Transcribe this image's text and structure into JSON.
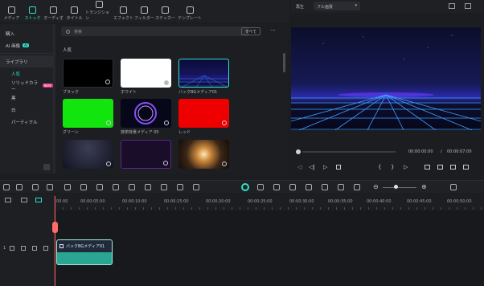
{
  "toolbar": {
    "items": [
      {
        "label": "メディア"
      },
      {
        "label": "ストック"
      },
      {
        "label": "オーディオ"
      },
      {
        "label": "タイトル"
      },
      {
        "label": "トランジション"
      },
      {
        "label": "エフェクト"
      },
      {
        "label": "フィルター"
      },
      {
        "label": "ステッカー"
      },
      {
        "label": "テンプレート"
      }
    ]
  },
  "sidebar": {
    "items": [
      {
        "label": "購入"
      },
      {
        "label": "AI 画像",
        "badge": "AI"
      },
      {
        "label": "ライブラリ"
      },
      {
        "label": "人気"
      },
      {
        "label": "ソリッドカラー",
        "badge": "NEW"
      },
      {
        "label": "黒"
      },
      {
        "label": "白"
      },
      {
        "label": "パーティクル"
      }
    ]
  },
  "media": {
    "search_placeholder": "検索",
    "filter_label": "すべて",
    "more_label": "···",
    "section_title": "人気",
    "thumbnails": [
      {
        "label": "ブラック"
      },
      {
        "label": "ホワイト"
      },
      {
        "label": "バックBGメディア01"
      },
      {
        "label": "グリーン"
      },
      {
        "label": "技術背景メディア 05"
      },
      {
        "label": "レッド"
      },
      {
        "label": ""
      },
      {
        "label": ""
      },
      {
        "label": ""
      }
    ]
  },
  "preview": {
    "mode_label": "再生",
    "quality_label": "フル画質",
    "current_time": "00:00:00:00",
    "separator": "/",
    "total_time": "00:00:07:00"
  },
  "timeline": {
    "ticks": [
      "00:00",
      "00:00:05:00",
      "00:00:10:00",
      "00:00:15:00",
      "00:00:20:00",
      "00:00:25:00",
      "00:00:30:00",
      "00:00:35:00",
      "00:00:40:00",
      "00:00:45:00",
      "00:00:50:00"
    ],
    "clip_label": "バックBGメディア01",
    "track_label": "1"
  },
  "colors": {
    "accent": "#2fe1c7",
    "playhead": "#ff5a5a",
    "clip": "#2aa592"
  }
}
